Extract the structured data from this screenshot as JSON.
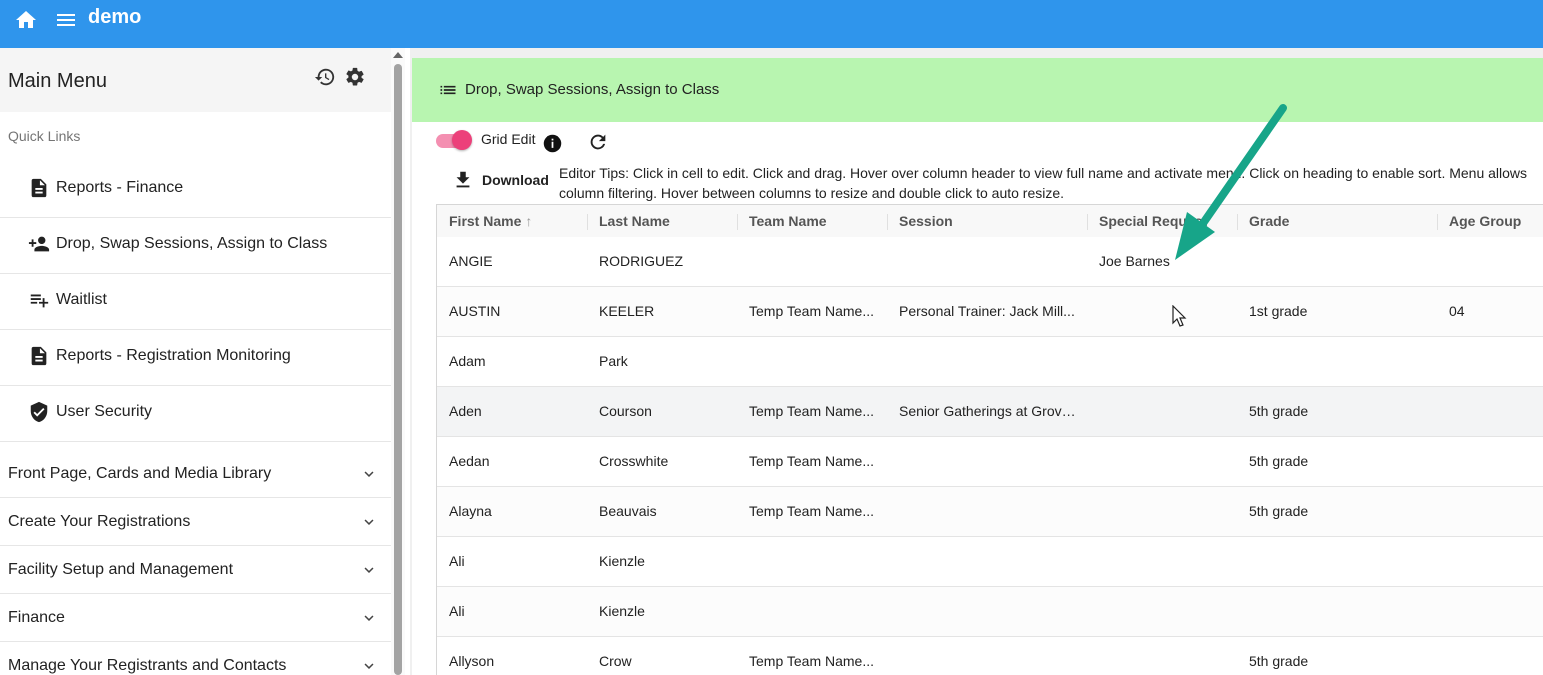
{
  "app": {
    "title": "demo"
  },
  "colors": {
    "topbar": "#2f95ec",
    "banner": "#b8f5b0",
    "toggle": "#ec407a",
    "arrow": "#17a589"
  },
  "sidebar": {
    "title": "Main Menu",
    "quick_links_label": "Quick Links",
    "quick_links": [
      {
        "label": "Reports - Finance",
        "icon": "document-icon"
      },
      {
        "label": "Drop, Swap Sessions, Assign to Class",
        "icon": "person-add-icon"
      },
      {
        "label": "Waitlist",
        "icon": "playlist-add-icon"
      },
      {
        "label": "Reports - Registration Monitoring",
        "icon": "document-icon"
      },
      {
        "label": "User Security",
        "icon": "shield-check-icon"
      }
    ],
    "sections": [
      {
        "label": "Front Page, Cards and Media Library"
      },
      {
        "label": "Create Your Registrations"
      },
      {
        "label": "Facility Setup and Management"
      },
      {
        "label": "Finance"
      },
      {
        "label": "Manage Your Registrants and Contacts"
      }
    ]
  },
  "main": {
    "banner_title": "Drop, Swap Sessions, Assign to Class",
    "grid_edit_label": "Grid Edit",
    "download_label": "Download",
    "tips": "Editor Tips: Click in cell to edit. Click and drag. Hover over column header to view full name and activate menu. Click on heading to enable sort. Menu allows column filtering. Hover between columns to resize and double click to auto resize."
  },
  "grid": {
    "columns": [
      "First Name",
      "Last Name",
      "Team Name",
      "Session",
      "Special Request",
      "Grade",
      "Age Group"
    ],
    "sort_indicator": "↑",
    "rows": [
      [
        "ANGIE",
        "RODRIGUEZ",
        "",
        "",
        "Joe Barnes",
        "",
        ""
      ],
      [
        "AUSTIN",
        "KEELER",
        "Temp Team Name...",
        "Personal Trainer: Jack Mill...",
        "",
        "1st grade",
        "04"
      ],
      [
        "Adam",
        "Park",
        "",
        "",
        "",
        "",
        ""
      ],
      [
        "Aden",
        "Courson",
        "Temp Team Name...",
        "Senior Gatherings at Grove...",
        "",
        "5th grade",
        ""
      ],
      [
        "Aedan",
        "Crosswhite",
        "Temp Team Name...",
        "",
        "",
        "5th grade",
        ""
      ],
      [
        "Alayna",
        "Beauvais",
        "Temp Team Name...",
        "",
        "",
        "5th grade",
        ""
      ],
      [
        "Ali",
        "Kienzle",
        "",
        "",
        "",
        "",
        ""
      ],
      [
        "Ali",
        "Kienzle",
        "",
        "",
        "",
        "",
        ""
      ],
      [
        "Allyson",
        "Crow",
        "Temp Team Name...",
        "",
        "",
        "5th grade",
        ""
      ]
    ]
  }
}
